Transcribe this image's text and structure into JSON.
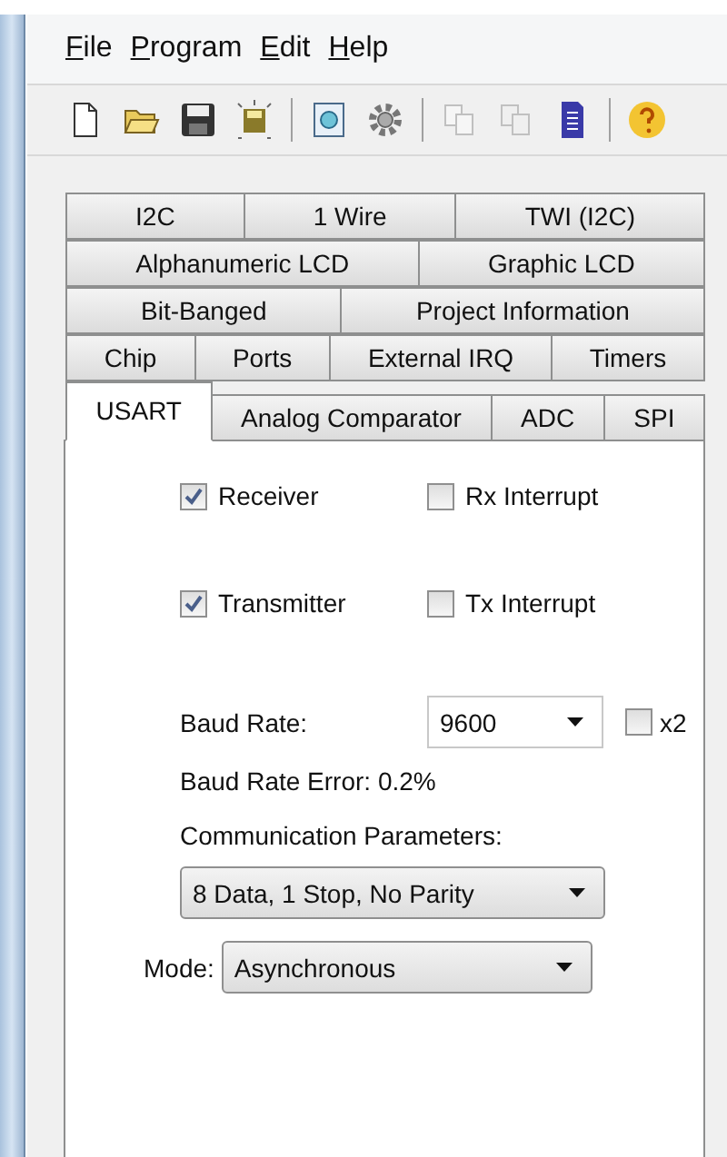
{
  "menu": [
    {
      "label": "File"
    },
    {
      "label": "Program"
    },
    {
      "label": "Edit"
    },
    {
      "label": "Help"
    }
  ],
  "toolbar": [
    {
      "kind": "new",
      "disabled": false
    },
    {
      "kind": "open",
      "disabled": false
    },
    {
      "kind": "save",
      "disabled": false
    },
    {
      "kind": "save-all",
      "disabled": false
    },
    {
      "kind": "separator"
    },
    {
      "kind": "preview",
      "disabled": false
    },
    {
      "kind": "gear",
      "disabled": false
    },
    {
      "kind": "separator"
    },
    {
      "kind": "copy",
      "disabled": true
    },
    {
      "kind": "paste",
      "disabled": true
    },
    {
      "kind": "document",
      "disabled": false
    },
    {
      "kind": "separator"
    },
    {
      "kind": "help",
      "disabled": false
    }
  ],
  "tab_rows": [
    [
      {
        "label": "I2C",
        "selected": false
      },
      {
        "label": "1 Wire",
        "selected": false
      },
      {
        "label": "TWI (I2C)",
        "selected": false
      }
    ],
    [
      {
        "label": "Alphanumeric LCD",
        "selected": false
      },
      {
        "label": "Graphic LCD",
        "selected": false
      }
    ],
    [
      {
        "label": "Bit-Banged",
        "selected": false
      },
      {
        "label": "Project Information",
        "selected": false
      }
    ],
    [
      {
        "label": "Chip",
        "selected": false
      },
      {
        "label": "Ports",
        "selected": false
      },
      {
        "label": "External IRQ",
        "selected": false
      },
      {
        "label": "Timers",
        "selected": false
      }
    ],
    [
      {
        "label": "USART",
        "selected": true
      },
      {
        "label": "Analog Comparator",
        "selected": false
      },
      {
        "label": "ADC",
        "selected": false
      },
      {
        "label": "SPI",
        "selected": false
      }
    ]
  ],
  "checkbox_rows": [
    [
      {
        "label": "Receiver",
        "checked": true
      },
      {
        "label": "Rx Interrupt",
        "checked": false
      }
    ],
    [
      {
        "label": "Transmitter",
        "checked": true
      },
      {
        "label": "Tx Interrupt",
        "checked": false
      }
    ]
  ],
  "baud_rate": {
    "label": "Baud Rate:",
    "value": "9600",
    "x2": {
      "label": "x2",
      "checked": false
    }
  },
  "baud_rate_error": "Baud Rate Error: 0.2%",
  "communication_parameters": {
    "label": "Communication Parameters:",
    "value": "8 Data, 1 Stop, No Parity"
  },
  "mode": {
    "label": "Mode:",
    "value": "Asynchronous"
  }
}
